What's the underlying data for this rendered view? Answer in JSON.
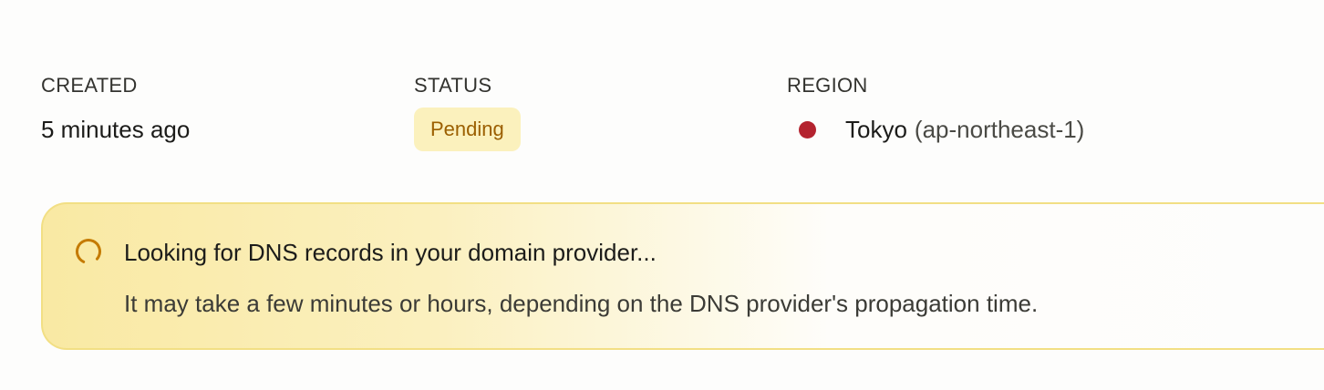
{
  "meta": {
    "created": {
      "label": "CREATED",
      "value": "5 minutes ago"
    },
    "status": {
      "label": "STATUS",
      "value": "Pending"
    },
    "region": {
      "label": "REGION",
      "name": "Tokyo",
      "code": "(ap-northeast-1)"
    }
  },
  "banner": {
    "title": "Looking for DNS records in your domain provider...",
    "description": "It may take a few minutes or hours, depending on the DNS provider's propagation time.",
    "icon": "spinner-icon"
  },
  "colors": {
    "badge_bg": "#fbf1bd",
    "badge_text": "#9b5f00",
    "flag_dot": "#b4232f",
    "banner_border": "#f2df84",
    "spinner": "#c47a00"
  }
}
